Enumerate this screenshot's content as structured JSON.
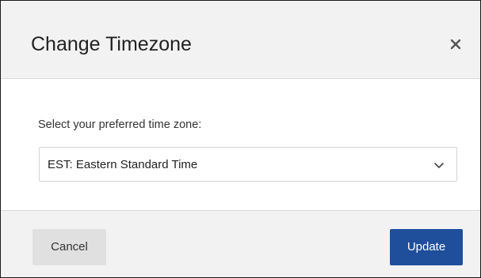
{
  "dialog": {
    "title": "Change Timezone",
    "close_icon": "close-icon"
  },
  "form": {
    "label": "Select your preferred time zone:",
    "selected_value": "EST: Eastern Standard Time",
    "dropdown_icon": "chevron-down-icon"
  },
  "footer": {
    "cancel_label": "Cancel",
    "update_label": "Update"
  },
  "colors": {
    "primary_button": "#1f4f9a",
    "secondary_button": "#e0e0e0",
    "header_background": "#f2f2f2"
  }
}
